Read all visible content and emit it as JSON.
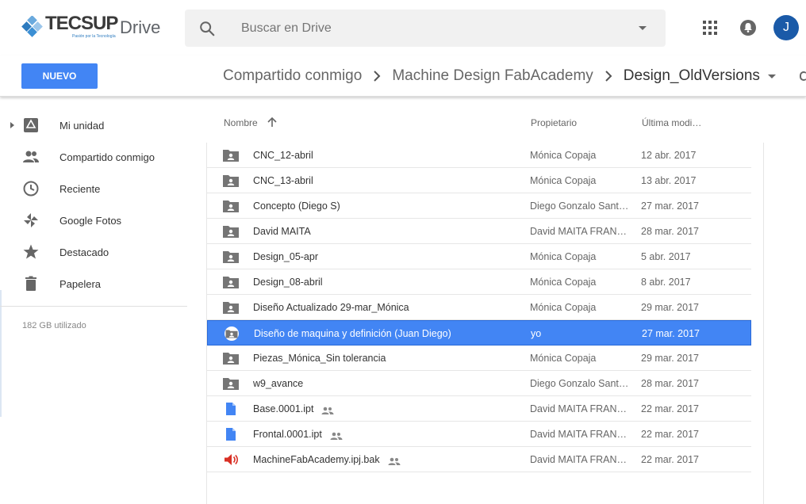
{
  "brand": {
    "logo_word": "TECSUP",
    "logo_tagline": "Pasión por la Tecnología",
    "product": "Drive"
  },
  "search": {
    "placeholder": "Buscar en Drive"
  },
  "account": {
    "initial": "J"
  },
  "toolbar": {
    "new_label": "NUEVO"
  },
  "breadcrumb": [
    {
      "label": "Compartido conmigo"
    },
    {
      "label": "Machine Design FabAcademy"
    },
    {
      "label": "Design_OldVersions"
    }
  ],
  "sidebar": {
    "items": [
      {
        "label": "Mi unidad",
        "icon": "drive-icon"
      },
      {
        "label": "Compartido conmigo",
        "icon": "people-icon"
      },
      {
        "label": "Reciente",
        "icon": "clock-icon"
      },
      {
        "label": "Google Fotos",
        "icon": "pinwheel-icon"
      },
      {
        "label": "Destacado",
        "icon": "star-icon"
      },
      {
        "label": "Papelera",
        "icon": "trash-icon"
      }
    ],
    "storage": "182 GB utilizado"
  },
  "columns": {
    "name": "Nombre",
    "owner": "Propietario",
    "modified": "Última modi…"
  },
  "files": [
    {
      "name": "CNC_12-abril",
      "owner": "Mónica Copaja",
      "modified": "12 abr. 2017",
      "type": "shared-folder"
    },
    {
      "name": "CNC_13-abril",
      "owner": "Mónica Copaja",
      "modified": "13 abr. 2017",
      "type": "shared-folder"
    },
    {
      "name": "Concepto (Diego S)",
      "owner": "Diego Gonzalo Sant…",
      "modified": "27 mar. 2017",
      "type": "shared-folder"
    },
    {
      "name": "David MAITA",
      "owner": "David MAITA FRANC…",
      "modified": "28 mar. 2017",
      "type": "shared-folder"
    },
    {
      "name": "Design_05-apr",
      "owner": "Mónica Copaja",
      "modified": "5 abr. 2017",
      "type": "shared-folder"
    },
    {
      "name": "Design_08-abril",
      "owner": "Mónica Copaja",
      "modified": "8 abr. 2017",
      "type": "shared-folder"
    },
    {
      "name": "Diseño Actualizado 29-mar_Mónica",
      "owner": "Mónica Copaja",
      "modified": "29 mar. 2017",
      "type": "shared-folder"
    },
    {
      "name": "Diseño de maquina y definición (Juan Diego)",
      "owner": "yo",
      "modified": "27 mar. 2017",
      "type": "shared-folder",
      "selected": true
    },
    {
      "name": "Piezas_Mónica_Sin tolerancia",
      "owner": "Mónica Copaja",
      "modified": "29 mar. 2017",
      "type": "shared-folder"
    },
    {
      "name": "w9_avance",
      "owner": "Diego Gonzalo Sant…",
      "modified": "28 mar. 2017",
      "type": "shared-folder"
    },
    {
      "name": "Base.0001.ipt",
      "owner": "David MAITA FRANC…",
      "modified": "22 mar. 2017",
      "type": "document",
      "shared": true
    },
    {
      "name": "Frontal.0001.ipt",
      "owner": "David MAITA FRANC…",
      "modified": "22 mar. 2017",
      "type": "document",
      "shared": true
    },
    {
      "name": "MachineFabAcademy.ipj.bak",
      "owner": "David MAITA FRANC…",
      "modified": "22 mar. 2017",
      "type": "audio",
      "shared": true
    }
  ],
  "colors": {
    "accent": "#4285f4",
    "avatar": "#1a5aa8",
    "audio": "#d93025"
  }
}
